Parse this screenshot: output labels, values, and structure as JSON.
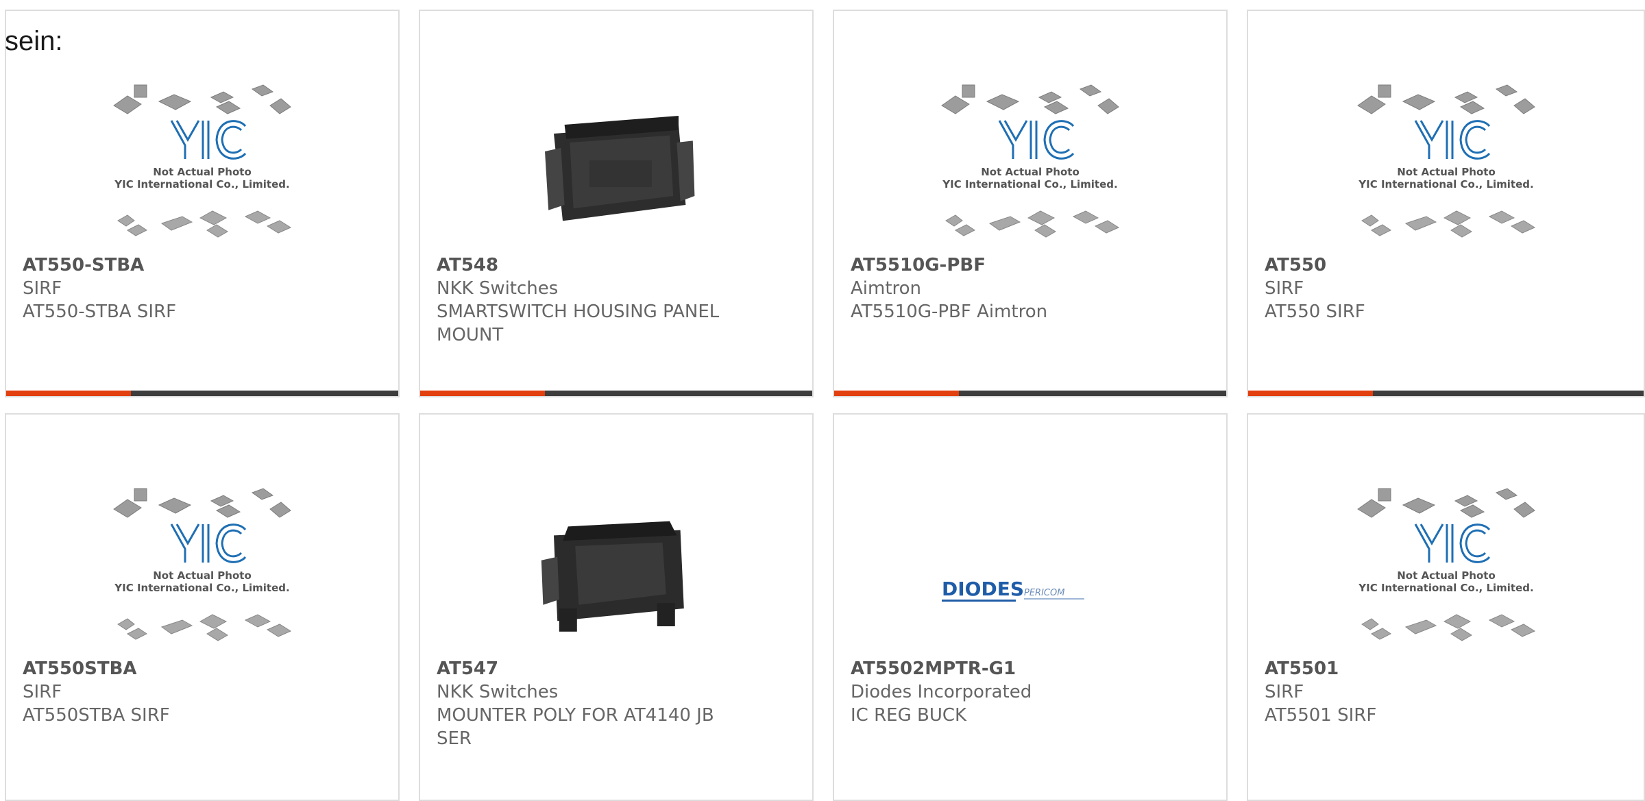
{
  "page": {
    "lead_text": "sein:"
  },
  "placeholder": {
    "brand": "YIC",
    "caption1": "Not Actual Photo",
    "caption2": "YIC International Co., Limited."
  },
  "colors": {
    "accent": "#e2400f",
    "bar": "#3d3d3d",
    "brand_blue": "#1f6fb4"
  },
  "products": [
    {
      "part": "AT550-STBA",
      "manufacturer": "SIRF",
      "description": "AT550-STBA SIRF",
      "image": "yic-placeholder"
    },
    {
      "part": "AT548",
      "manufacturer": "NKK Switches",
      "description": "SMARTSWITCH HOUSING PANEL MOUNT",
      "image": "switch-housing-photo"
    },
    {
      "part": "AT5510G-PBF",
      "manufacturer": "Aimtron",
      "description": "AT5510G-PBF Aimtron",
      "image": "yic-placeholder"
    },
    {
      "part": "AT550",
      "manufacturer": "SIRF",
      "description": "AT550 SIRF",
      "image": "yic-placeholder"
    },
    {
      "part": "AT550STBA",
      "manufacturer": "SIRF",
      "description": "AT550STBA SIRF",
      "image": "yic-placeholder"
    },
    {
      "part": "AT547",
      "manufacturer": "NKK Switches",
      "description": "MOUNTER POLY FOR AT4140 JB SER",
      "image": "switch-mounter-photo"
    },
    {
      "part": "AT5502MPTR-G1",
      "manufacturer": "Diodes Incorporated",
      "description": "IC REG BUCK",
      "image": "diodes-logo"
    },
    {
      "part": "AT5501",
      "manufacturer": "SIRF",
      "description": "AT5501 SIRF",
      "image": "yic-placeholder"
    }
  ],
  "logo": {
    "diodes": "DIODES",
    "pericom": "PERICOM"
  }
}
